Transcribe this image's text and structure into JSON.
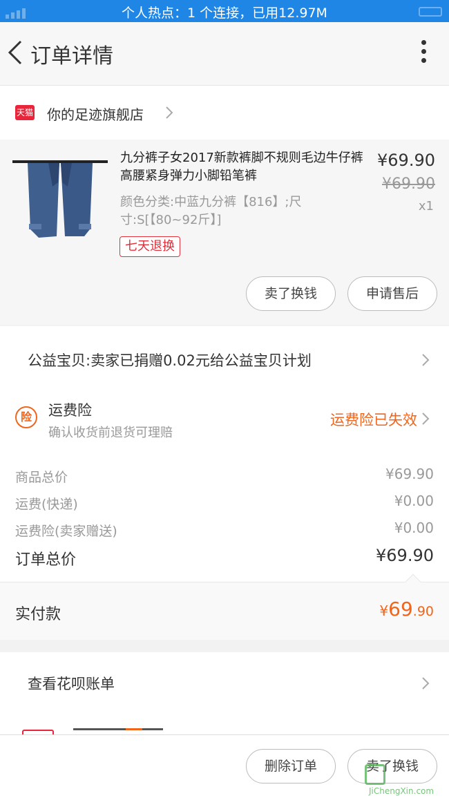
{
  "status_bar": {
    "text": "个人热点：1 个连接，已用12.97M"
  },
  "nav": {
    "title": "订单详情"
  },
  "shop": {
    "badge": "天猫",
    "name": "你的足迹旗舰店"
  },
  "item": {
    "title": "九分裤子女2017新款裤脚不规则毛边牛仔裤高腰紧身弹力小脚铅笔裤",
    "spec": "颜色分类:中蓝九分裤【816】;尺寸:S[【80~92斤】]",
    "price": "¥69.90",
    "original_price": "¥69.90",
    "quantity": "x1",
    "return_tag": "七天退换",
    "buttons": {
      "sell": "卖了换钱",
      "after_sale": "申请售后"
    }
  },
  "charity": {
    "text": "公益宝贝:卖家已捐赠0.02元给公益宝贝计划"
  },
  "insurance": {
    "icon_label": "险",
    "title": "运费险",
    "subtitle": "确认收货前退货可理赔",
    "status": "运费险已失效"
  },
  "fees": [
    {
      "label": "商品总价",
      "value": "¥69.90"
    },
    {
      "label": "运费(快递)",
      "value": "¥0.00"
    },
    {
      "label": "运费险(卖家赠送)",
      "value": "¥0.00"
    }
  ],
  "order_total": {
    "label": "订单总价",
    "value": "¥69.90"
  },
  "paid": {
    "label": "实付款",
    "currency": "¥",
    "integer": "69",
    "decimal": ".90"
  },
  "huabei": {
    "text": "查看花呗账单"
  },
  "bottom_bar": {
    "delete": "删除订单",
    "sell": "卖了换钱"
  },
  "watermark": {
    "site": "JiChengXin.com"
  },
  "colors": {
    "status_bar": "#1f86e6",
    "accent_orange": "#f0651c",
    "tmall_red": "#e8253a"
  }
}
